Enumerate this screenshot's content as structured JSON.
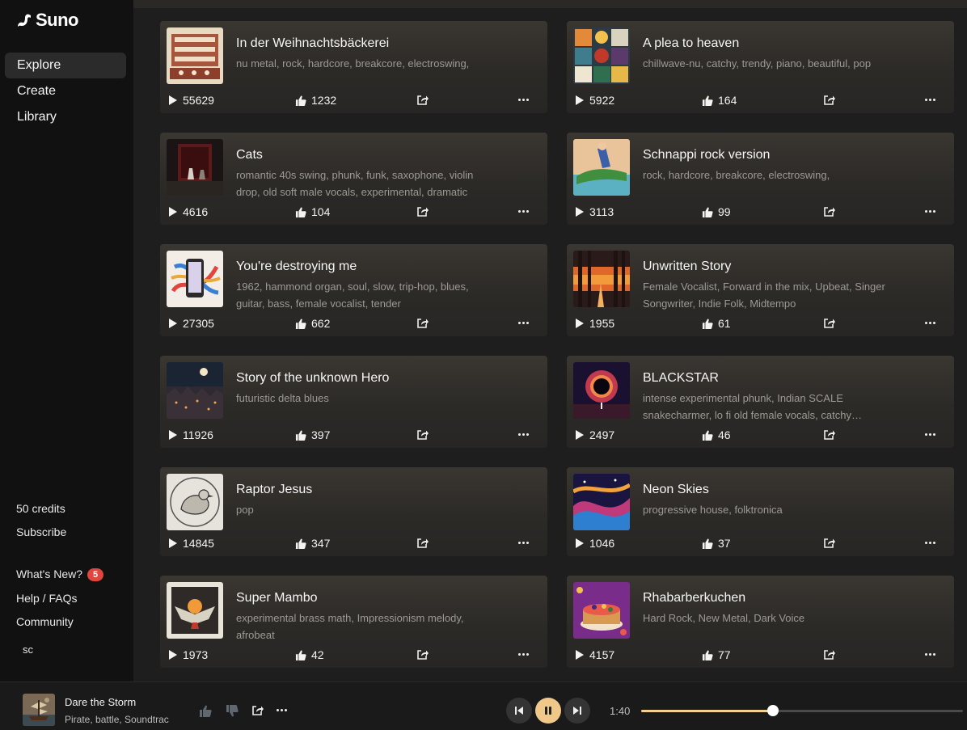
{
  "app": {
    "name": "Suno"
  },
  "nav": {
    "items": [
      "Explore",
      "Create",
      "Library"
    ],
    "active": "Explore"
  },
  "sidebar": {
    "credits": "50 credits",
    "subscribe": "Subscribe",
    "whats_new": "What's New?",
    "whats_new_badge": "5",
    "help": "Help / FAQs",
    "community": "Community",
    "user": "sc"
  },
  "songs": [
    {
      "title": "In der Weihnachtsbäckerei",
      "tags": "nu metal, rock, hardcore, breakcore, electroswing,",
      "plays": "55629",
      "likes": "1232",
      "art": "bakery"
    },
    {
      "title": "A plea to heaven",
      "tags": "chillwave-nu, catchy, trendy, piano, beautiful, pop",
      "plays": "5922",
      "likes": "164",
      "art": "collage"
    },
    {
      "title": "Cats",
      "tags": "romantic 40s swing, phunk, funk, saxophone, violin drop, old soft male vocals, experimental, dramatic",
      "plays": "4616",
      "likes": "104",
      "art": "dark-room"
    },
    {
      "title": "Schnappi rock version",
      "tags": "rock, hardcore, breakcore, electroswing,",
      "plays": "3113",
      "likes": "99",
      "art": "crocodile"
    },
    {
      "title": "You're destroying me",
      "tags": "1962, hammond organ, soul, slow, trip-hop, blues, guitar, bass, female vocalist, tender",
      "plays": "27305",
      "likes": "662",
      "art": "phone"
    },
    {
      "title": "Unwritten Story",
      "tags": "Female Vocalist, Forward in the mix, Upbeat, Singer Songwriter, Indie Folk, Midtempo",
      "plays": "1955",
      "likes": "61",
      "art": "forest"
    },
    {
      "title": "Story of the unknown Hero",
      "tags": "futuristic delta blues",
      "plays": "11926",
      "likes": "397",
      "art": "night-city"
    },
    {
      "title": "BLACKSTAR",
      "tags": "intense experimental phunk, Indian SCALE snakecharmer, lo fi old female vocals, catchy melody",
      "plays": "2497",
      "likes": "46",
      "art": "blackhole"
    },
    {
      "title": "Raptor Jesus",
      "tags": "pop",
      "plays": "14845",
      "likes": "347",
      "art": "bird-sketch"
    },
    {
      "title": "Neon Skies",
      "tags": "progressive house, folktronica",
      "plays": "1046",
      "likes": "37",
      "art": "nebula"
    },
    {
      "title": "Super Mambo",
      "tags": "experimental brass math, Impressionism melody, afrobeat",
      "plays": "1973",
      "likes": "42",
      "art": "eagle"
    },
    {
      "title": "Rhabarberkuchen",
      "tags": "Hard Rock, New Metal, Dark Voice",
      "plays": "4157",
      "likes": "77",
      "art": "cake"
    }
  ],
  "player": {
    "title": "Dare the Storm",
    "subtitle": "Pirate, battle, Soundtrac",
    "elapsed": "1:40",
    "progress": 0.41,
    "state": "playing"
  },
  "colors": {
    "accent": "#f0c98a",
    "badge": "#e0453e"
  }
}
